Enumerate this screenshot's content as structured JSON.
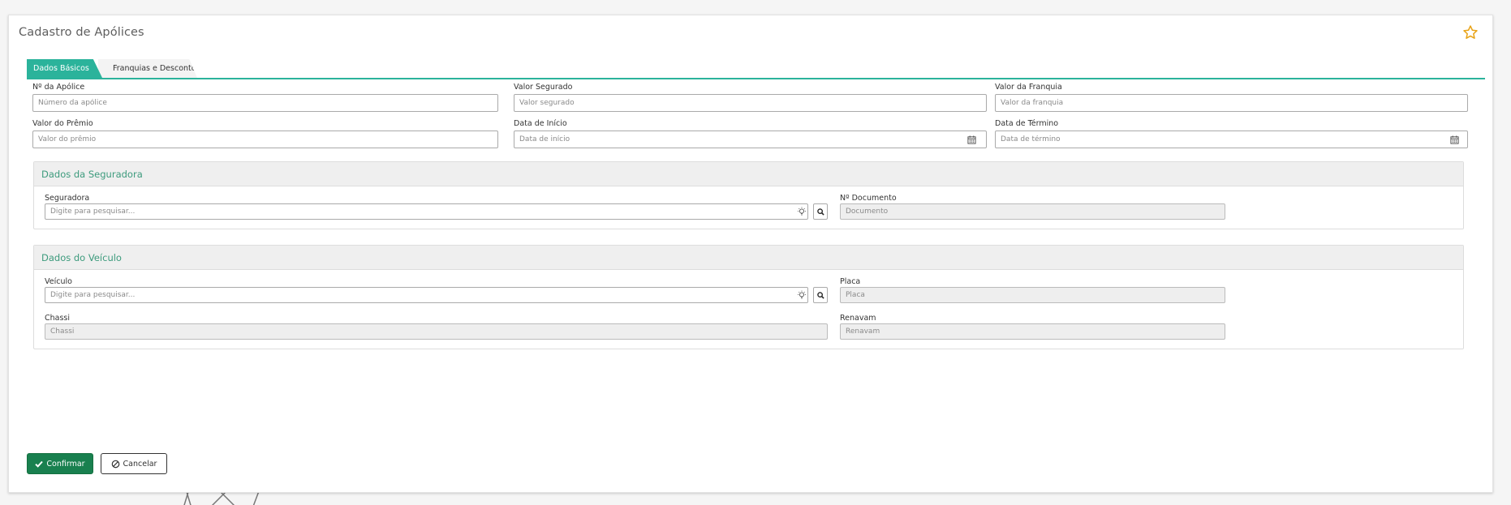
{
  "page": {
    "title": "Cadastro de Apólices",
    "star_icon": "star-outline-icon",
    "accent_color": "#2bb39b",
    "star_color": "#e8a317"
  },
  "tabs": [
    {
      "label": "Dados Básicos",
      "active": true
    },
    {
      "label": "Franquias e Descontos",
      "active": false
    }
  ],
  "fields": {
    "numero_apolice": {
      "label": "Nº da Apólice",
      "placeholder": "Número da apólice",
      "value": ""
    },
    "valor_segurado": {
      "label": "Valor Segurado",
      "placeholder": "Valor segurado",
      "value": ""
    },
    "valor_franquia": {
      "label": "Valor da Franquia",
      "placeholder": "Valor da franquia",
      "value": ""
    },
    "valor_premio": {
      "label": "Valor do Prêmio",
      "placeholder": "Valor do prêmio",
      "value": ""
    },
    "data_inicio": {
      "label": "Data de Início",
      "placeholder": "Data de início",
      "value": "",
      "icon": "calendar-icon"
    },
    "data_termino": {
      "label": "Data de Término",
      "placeholder": "Data de término",
      "value": "",
      "icon": "calendar-icon"
    }
  },
  "seguradora_section": {
    "title": "Dados da Seguradora",
    "seguradora": {
      "label": "Seguradora",
      "placeholder": "Digite para pesquisar...",
      "value": ""
    },
    "documento": {
      "label": "Nº Documento",
      "placeholder": "Documento",
      "value": ""
    }
  },
  "veiculo_section": {
    "title": "Dados do Veículo",
    "veiculo": {
      "label": "Veículo",
      "placeholder": "Digite para pesquisar...",
      "value": ""
    },
    "placa": {
      "label": "Placa",
      "placeholder": "Placa",
      "value": ""
    },
    "chassi": {
      "label": "Chassi",
      "placeholder": "Chassi",
      "value": ""
    },
    "renavam": {
      "label": "Renavam",
      "placeholder": "Renavam",
      "value": ""
    }
  },
  "actions": {
    "confirm_label": "Confirmar",
    "cancel_label": "Cancelar",
    "confirm_color": "#19804f"
  }
}
